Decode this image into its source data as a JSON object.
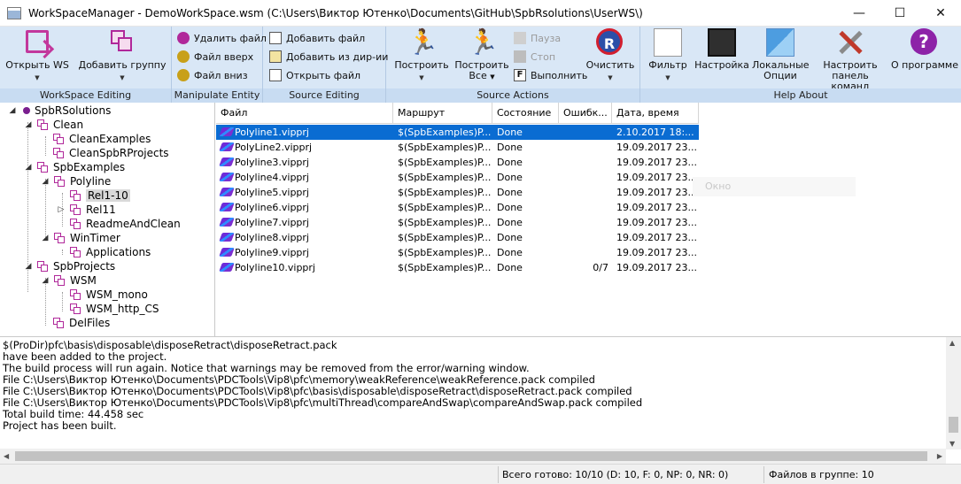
{
  "window": {
    "title": "WorkSpaceManager - DemoWorkSpace.wsm (C:\\Users\\Виктор Ютенко\\Documents\\GitHub\\SpbRsolutions\\UserWS\\)",
    "minimize": "—",
    "maximize": "☐",
    "close": "✕"
  },
  "ribbon": {
    "groups": {
      "workspace_editing": "WorkSpace Editing",
      "manipulate_entity": "Manipulate Entity",
      "source_editing": "Source Editing",
      "source_actions": "Source Actions",
      "help_about": "Help  About"
    },
    "open_ws": "Открыть WS",
    "add_group": "Добавить группу",
    "delete_file": "Удалить файл",
    "file_up": "Файл вверх",
    "file_down": "Файл вниз",
    "add_file": "Добавить файл",
    "add_from_dir": "Добавить из дир-ии",
    "open_file": "Открыть файл",
    "build": "Построить",
    "build_all_line1": "Построить",
    "build_all_line2": "Все",
    "pause": "Пауза",
    "stop": "Стоп",
    "execute": "Выполнить",
    "clean": "Очистить",
    "filter": "Фильтр",
    "settings": "Настройка",
    "local_options_line1": "Локальные",
    "local_options_line2": "Опции",
    "configure_panel_line1": "Настроить",
    "configure_panel_line2": "панель команд",
    "about": "О программе",
    "dropdown_arrow": "▼"
  },
  "tree": {
    "expanded_glyph": "◢",
    "collapsed_glyph": "▷",
    "nodes": [
      {
        "label": "SpbRSolutions"
      },
      {
        "label": "Clean"
      },
      {
        "label": "CleanExamples"
      },
      {
        "label": "CleanSpbRProjects"
      },
      {
        "label": "SpbExamples"
      },
      {
        "label": "Polyline"
      },
      {
        "label": "Rel1-10"
      },
      {
        "label": "Rel11"
      },
      {
        "label": "ReadmeAndClean"
      },
      {
        "label": "WinTimer"
      },
      {
        "label": "Applications"
      },
      {
        "label": "SpbProjects"
      },
      {
        "label": "WSM"
      },
      {
        "label": "WSM_mono"
      },
      {
        "label": "WSM_http_CS"
      },
      {
        "label": "DelFiles"
      }
    ]
  },
  "grid": {
    "columns": [
      "Файл",
      "Маршрут",
      "Состояние",
      "Ошибк...",
      "Дата, время"
    ],
    "rows": [
      {
        "file": "Polyline1.vipprj",
        "route": "$(SpbExamples)P...",
        "state": "Done",
        "errors": "",
        "date": "2.10.2017 18:..."
      },
      {
        "file": "PolyLine2.vipprj",
        "route": "$(SpbExamples)P...",
        "state": "Done",
        "errors": "",
        "date": "19.09.2017 23..."
      },
      {
        "file": "Polyline3.vipprj",
        "route": "$(SpbExamples)P...",
        "state": "Done",
        "errors": "",
        "date": "19.09.2017 23..."
      },
      {
        "file": "Polyline4.vipprj",
        "route": "$(SpbExamples)P...",
        "state": "Done",
        "errors": "",
        "date": "19.09.2017 23..."
      },
      {
        "file": "Polyline5.vipprj",
        "route": "$(SpbExamples)P...",
        "state": "Done",
        "errors": "",
        "date": "19.09.2017 23..."
      },
      {
        "file": "Polyline6.vipprj",
        "route": "$(SpbExamples)P...",
        "state": "Done",
        "errors": "",
        "date": "19.09.2017 23..."
      },
      {
        "file": "Polyline7.vipprj",
        "route": "$(SpbExamples)P...",
        "state": "Done",
        "errors": "",
        "date": "19.09.2017 23..."
      },
      {
        "file": "Polyline8.vipprj",
        "route": "$(SpbExamples)P...",
        "state": "Done",
        "errors": "",
        "date": "19.09.2017 23..."
      },
      {
        "file": "Polyline9.vipprj",
        "route": "$(SpbExamples)P...",
        "state": "Done",
        "errors": "",
        "date": "19.09.2017 23..."
      },
      {
        "file": "Polyline10.vipprj",
        "route": "$(SpbExamples)P...",
        "state": "Done",
        "errors": "0/7",
        "date": "19.09.2017 23..."
      }
    ],
    "ghost_label": "Окно"
  },
  "log": {
    "lines": [
      "   $(ProDir)pfc\\basis\\disposable\\disposeRetract\\disposeRetract.pack",
      "have been added to the project.",
      "The build process will run again. Notice that warnings may be removed from the error/warning window.",
      "File C:\\Users\\Виктор Ютенко\\Documents\\PDCTools\\Vip8\\pfc\\memory\\weakReference\\weakReference.pack compiled",
      "File C:\\Users\\Виктор Ютенко\\Documents\\PDCTools\\Vip8\\pfc\\basis\\disposable\\disposeRetract\\disposeRetract.pack compiled",
      "File C:\\Users\\Виктор Ютенко\\Documents\\PDCTools\\Vip8\\pfc\\multiThread\\compareAndSwap\\compareAndSwap.pack compiled",
      "Total build time: 44.458 sec",
      "Project has been built."
    ]
  },
  "status": {
    "ready": "Всего готово: 10/10 (D: 10, F: 0, NP: 0, NR: 0)",
    "files_in_group": "Файлов в группе: 10"
  }
}
